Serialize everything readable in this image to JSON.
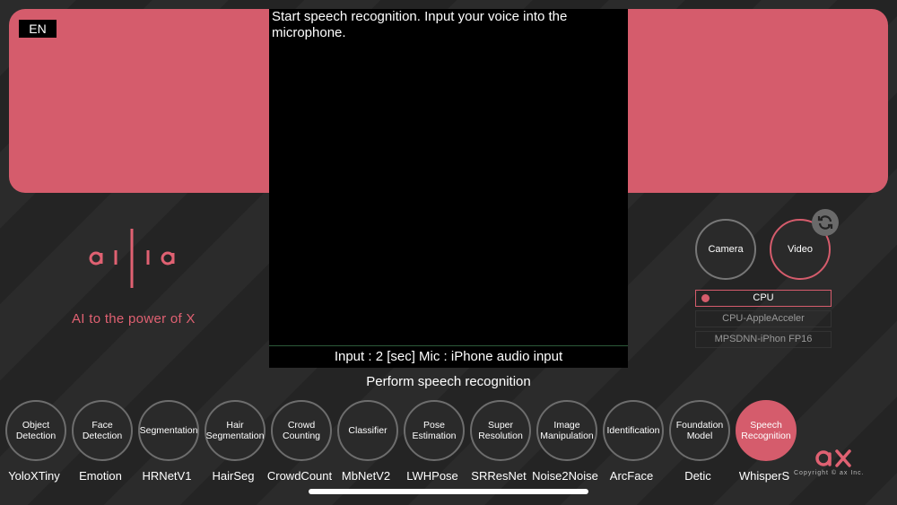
{
  "language": "EN",
  "video": {
    "instruction": "Start speech recognition. Input your voice into the microphone.",
    "input_info": "Input : 2 [sec] Mic : iPhone audio input"
  },
  "caption": "Perform speech recognition",
  "brand": {
    "tagline": "AI to the power of X",
    "copyright": "Copyright © ax Inc."
  },
  "modes": {
    "camera": "Camera",
    "video": "Video"
  },
  "accelerators": [
    "CPU",
    "CPU-AppleAcceler",
    "MPSDNN-iPhon FP16"
  ],
  "categories": [
    {
      "label": "Object Detection",
      "model": "YoloXTiny"
    },
    {
      "label": "Face Detection",
      "model": "Emotion"
    },
    {
      "label": "Segmentation",
      "model": "HRNetV1"
    },
    {
      "label": "Hair Segmentation",
      "model": "HairSeg"
    },
    {
      "label": "Crowd Counting",
      "model": "CrowdCount"
    },
    {
      "label": "Classifier",
      "model": "MbNetV2"
    },
    {
      "label": "Pose Estimation",
      "model": "LWHPose"
    },
    {
      "label": "Super Resolution",
      "model": "SRResNet"
    },
    {
      "label": "Image Manipulation",
      "model": "Noise2Noise"
    },
    {
      "label": "Identification",
      "model": "ArcFace"
    },
    {
      "label": "Foundation Model",
      "model": "Detic"
    },
    {
      "label": "Speech Recognition",
      "model": "WhisperS"
    }
  ],
  "colors": {
    "accent": "#d55c6c",
    "background": "#262626"
  },
  "icons": {
    "refresh": "refresh-icon"
  }
}
